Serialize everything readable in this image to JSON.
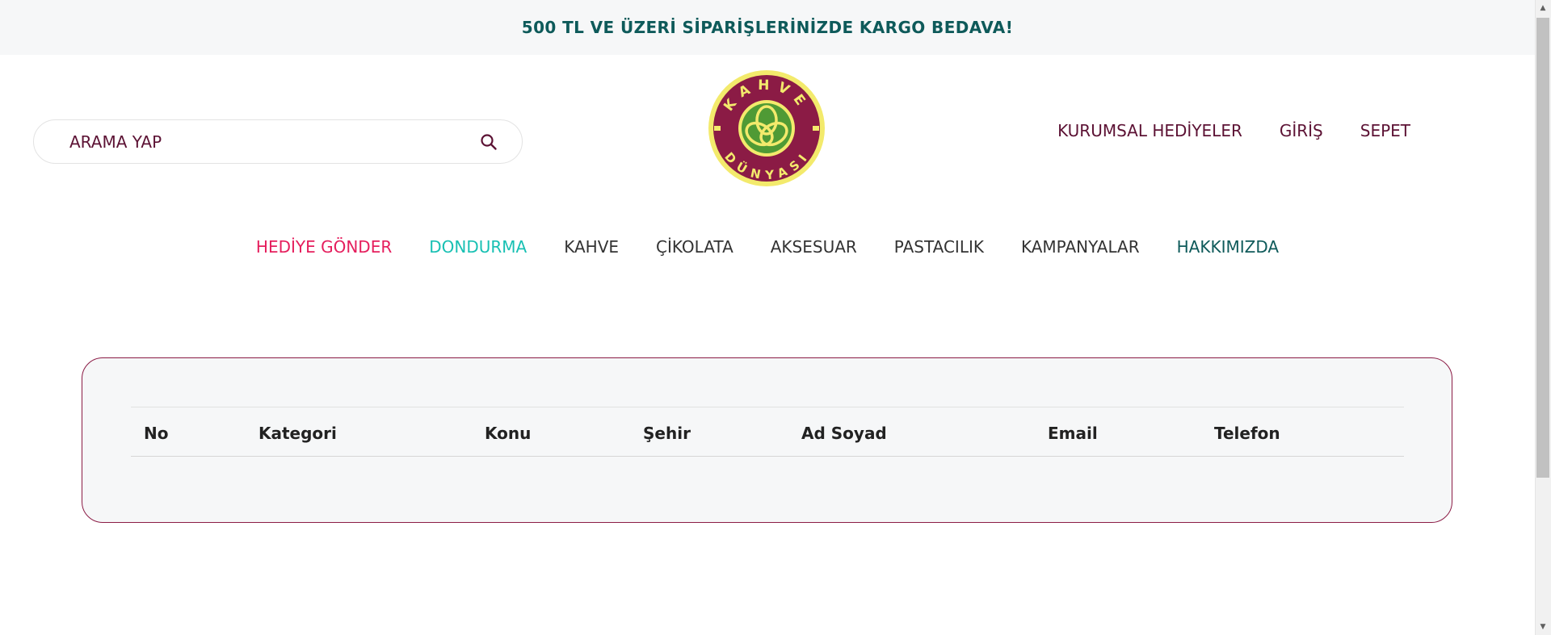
{
  "promo": {
    "text": "500 TL VE ÜZERİ SİPARİŞLERİNİZDE KARGO BEDAVA!"
  },
  "search": {
    "placeholder": "ARAMA YAP",
    "value": ""
  },
  "logo": {
    "text_top": "KAHVE",
    "text_bottom": "DÜNYASI",
    "colors": {
      "ring": "#f3ea6c",
      "disc": "#8b1b45",
      "emblem": "#4f9a35"
    }
  },
  "header_links": [
    {
      "label": "KURUMSAL HEDİYELER"
    },
    {
      "label": "GİRİŞ"
    },
    {
      "label": "SEPET"
    }
  ],
  "nav": [
    {
      "label": "HEDİYE GÖNDER",
      "color": "#e51e5d"
    },
    {
      "label": "DONDURMA",
      "color": "#18c0b3"
    },
    {
      "label": "KAHVE",
      "color": "#333333"
    },
    {
      "label": "ÇİKOLATA",
      "color": "#333333"
    },
    {
      "label": "AKSESUAR",
      "color": "#333333"
    },
    {
      "label": "PASTACILIK",
      "color": "#333333"
    },
    {
      "label": "KAMPANYALAR",
      "color": "#333333"
    },
    {
      "label": "HAKKIMIZDA",
      "color": "#0e5a5a"
    }
  ],
  "table": {
    "columns": [
      "No",
      "Kategori",
      "Konu",
      "Şehir",
      "Ad Soyad",
      "Email",
      "Telefon"
    ],
    "rows": []
  },
  "colors": {
    "brand": "#5c1234",
    "accent_border": "#8b1b45",
    "promo_text": "#0e5a5a"
  }
}
